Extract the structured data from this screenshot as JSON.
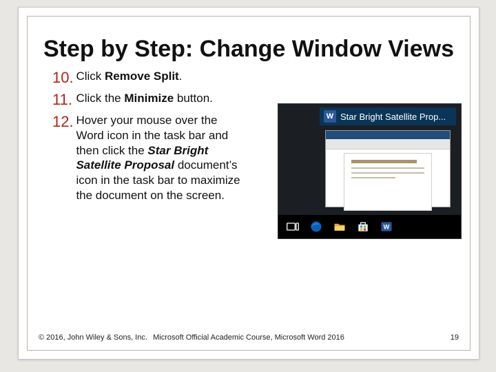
{
  "title": "Step by Step: Change Window Views",
  "steps": [
    {
      "num": "10.",
      "pre": "Click ",
      "bold": "Remove Split",
      "post": "."
    },
    {
      "num": "11.",
      "pre": "Click the ",
      "bold": "Minimize",
      "post": " button."
    },
    {
      "num": "12.",
      "pre": "Hover your mouse over the Word icon in the task bar and then click the ",
      "bold": "Star Bright Satellite Proposal",
      "post": " document’s icon in the task bar to maximize the document on the screen."
    }
  ],
  "figure": {
    "word_badge": "W",
    "window_title": "Star Bright Satellite Prop..."
  },
  "footer": {
    "left": "© 2016, John Wiley & Sons, Inc.",
    "center": "Microsoft Official Academic Course, Microsoft Word 2016",
    "page": "19"
  }
}
